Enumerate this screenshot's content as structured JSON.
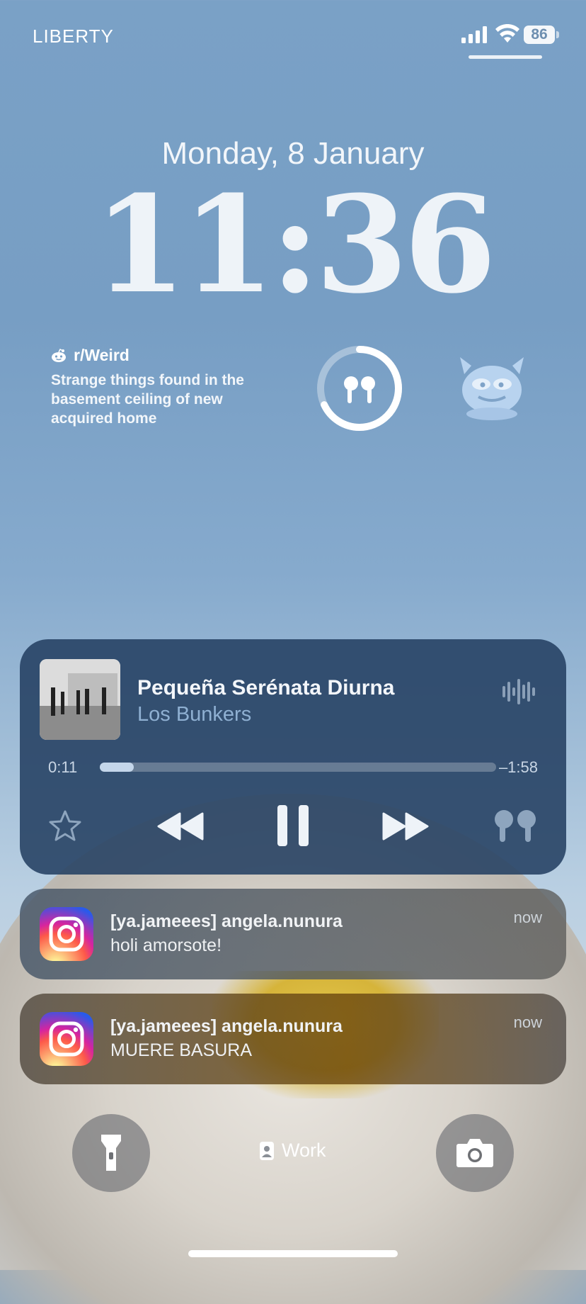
{
  "status_bar": {
    "carrier": "LIBERTY",
    "battery_level": "86",
    "signal_icon": "cellular-signal-icon",
    "wifi_icon": "wifi-icon"
  },
  "lock_screen": {
    "date": "Monday, 8 January",
    "time": "11:36"
  },
  "widgets": {
    "reddit": {
      "icon": "reddit-icon",
      "subreddit": "r/Weird",
      "post_title": "Strange things found in the basement ceiling of new acquired home"
    },
    "airpods_battery": {
      "icon": "airpods-icon",
      "level_fraction": 0.68
    },
    "sticker": {
      "icon": "pepe-frog-sticker-icon"
    }
  },
  "now_playing": {
    "title": "Pequeña Serénata Diurna",
    "artist": "Los Bunkers",
    "elapsed": "0:11",
    "remaining": "–1:58",
    "progress_fraction": 0.085,
    "controls": [
      "star-icon",
      "rewind-icon",
      "pause-icon",
      "fast-forward-icon",
      "airpods-output-icon"
    ]
  },
  "notifications": [
    {
      "app_icon": "instagram-icon",
      "title": "[ya.jameees] angela.nunura",
      "body": "holi amorsote!",
      "time": "now"
    },
    {
      "app_icon": "instagram-icon",
      "title": "[ya.jameees] angela.nunura",
      "body": "MUERE BASURA",
      "time": "now"
    }
  ],
  "bottom": {
    "focus_label": "Work",
    "flashlight_icon": "flashlight-icon",
    "camera_icon": "camera-icon"
  }
}
